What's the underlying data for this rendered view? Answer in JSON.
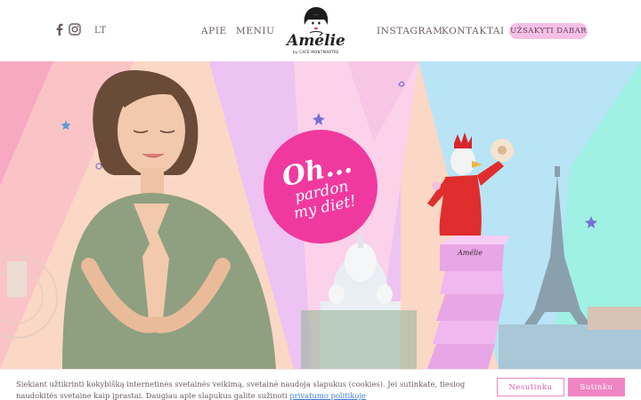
{
  "header": {
    "social": [
      {
        "icon": "facebook-icon"
      },
      {
        "icon": "instagram-icon"
      }
    ],
    "language": "LT",
    "nav_left": [
      "APIE",
      "MENIU"
    ],
    "nav_right": [
      "INSTAGRAM",
      "KONTAKTAI"
    ],
    "logo": {
      "word": "Amélie",
      "sub": "by CAFÉ MONTMARTRE"
    },
    "cta_label": "UŽSAKYTI DABAR"
  },
  "hero": {
    "badge": {
      "line1": "Oh...",
      "line2": "pardon",
      "line3": "my diet!"
    },
    "box_label": "Amélie",
    "colors": {
      "peach": "#fbd7c6",
      "lavender": "#ecc3f2",
      "pink": "#f8a9c2",
      "light_pink": "#fbd2ea",
      "sky": "#b8e4f6",
      "mint": "#9ff1e4",
      "badge": "#f0399f"
    }
  },
  "cookie": {
    "text": "Siekiant užtikrinti kokybišką internetinės svetainės veikimą, svetainė naudoja slapukus (cookies). Jei sutinkate, tiesiog naudokitės svetaine kaip įprastai. Daugiau apie slapukus galite sužinoti",
    "link": "privatumo politikoje",
    "decline_label": "Nesutinku",
    "accept_label": "Sutinku"
  }
}
